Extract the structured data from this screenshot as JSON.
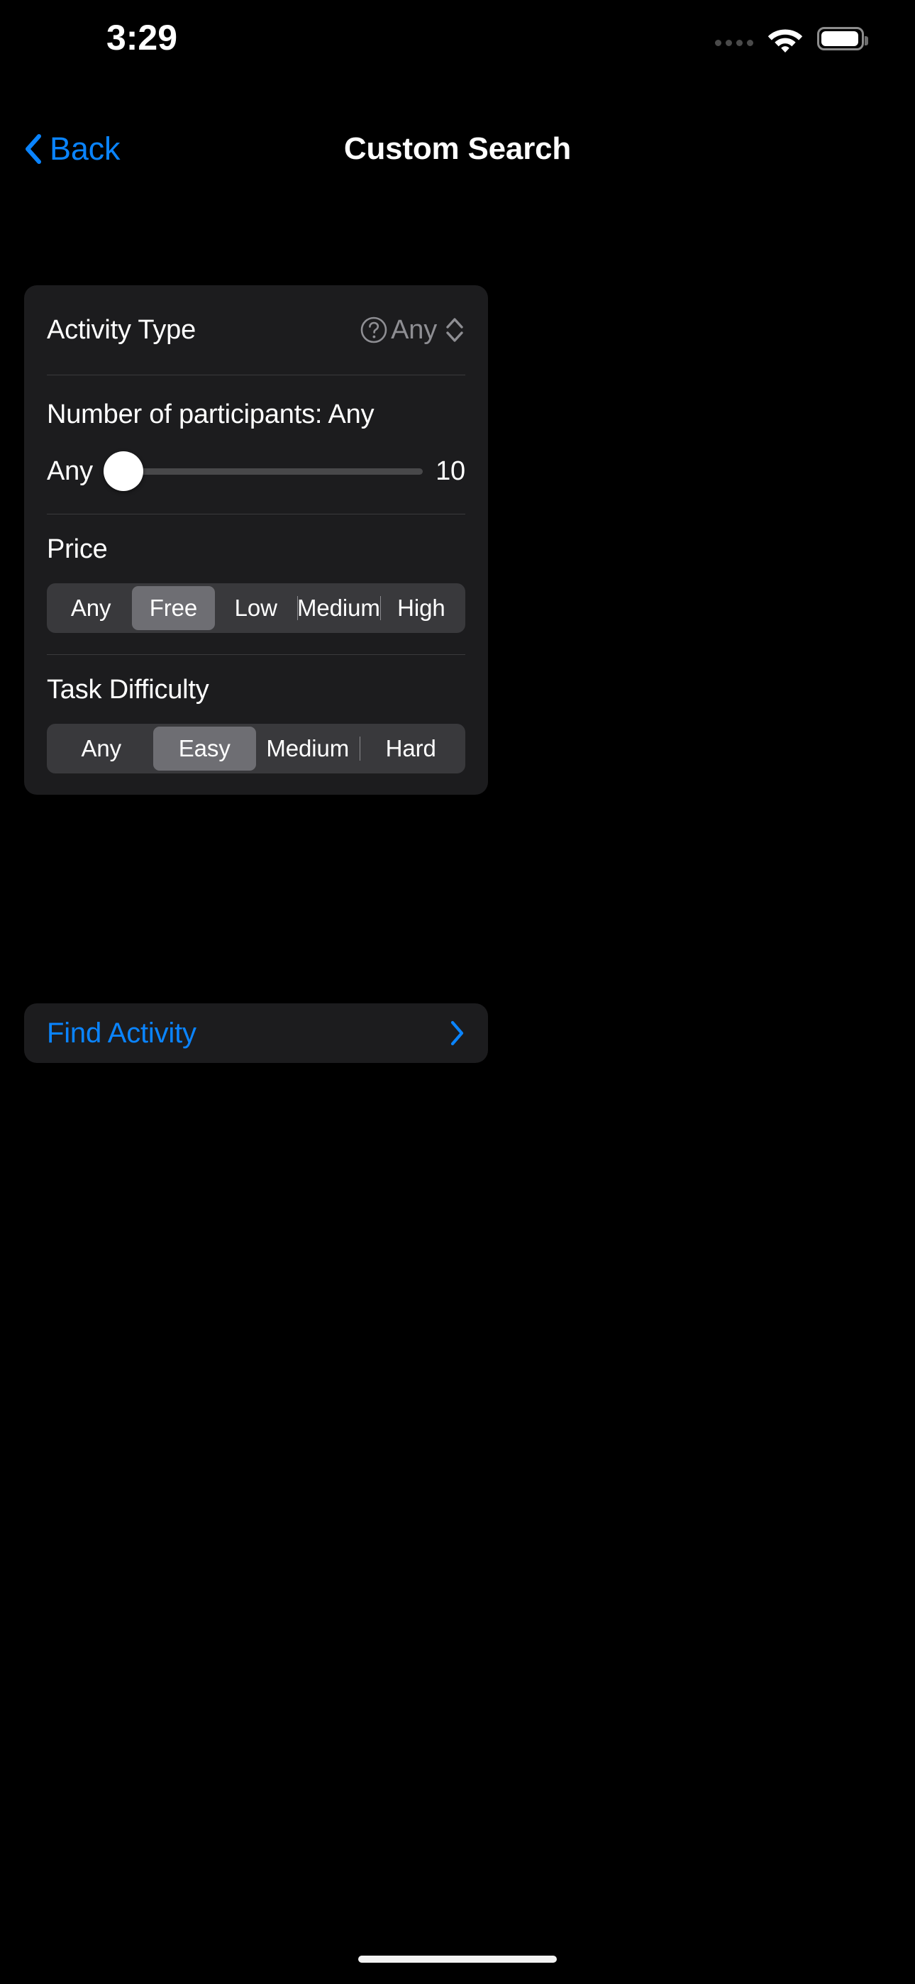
{
  "status_bar": {
    "time": "3:29",
    "signal_icon": "signal-dots-icon",
    "wifi_icon": "wifi-icon",
    "battery_icon": "battery-icon"
  },
  "nav": {
    "back_label": "Back",
    "back_icon": "chevron-left-icon",
    "title": "Custom Search"
  },
  "form": {
    "activity_type": {
      "label": "Activity Type",
      "help_icon": "question-mark-circle-icon",
      "value": "Any",
      "picker_icon": "chevron-up-down-icon"
    },
    "participants": {
      "label": "Number of participants: Any",
      "slider_min_label": "Any",
      "slider_max_label": "10",
      "slider_value": 0,
      "slider_min": 0,
      "slider_max": 10
    },
    "price": {
      "title": "Price",
      "options": [
        "Any",
        "Free",
        "Low",
        "Medium",
        "High"
      ],
      "selected": "Free",
      "selected_index": 1
    },
    "task_difficulty": {
      "title": "Task Difficulty",
      "options": [
        "Any",
        "Easy",
        "Medium",
        "Hard"
      ],
      "selected": "Easy",
      "selected_index": 1
    }
  },
  "actions": {
    "find_activity_label": "Find Activity",
    "find_activity_icon": "chevron-right-icon"
  },
  "colors": {
    "background": "#000000",
    "card": "#1C1C1E",
    "accent_blue": "#0A84FF",
    "secondary_text": "#8E8E93",
    "segment_bg": "#39393C",
    "segment_selected": "#6E6E73"
  }
}
